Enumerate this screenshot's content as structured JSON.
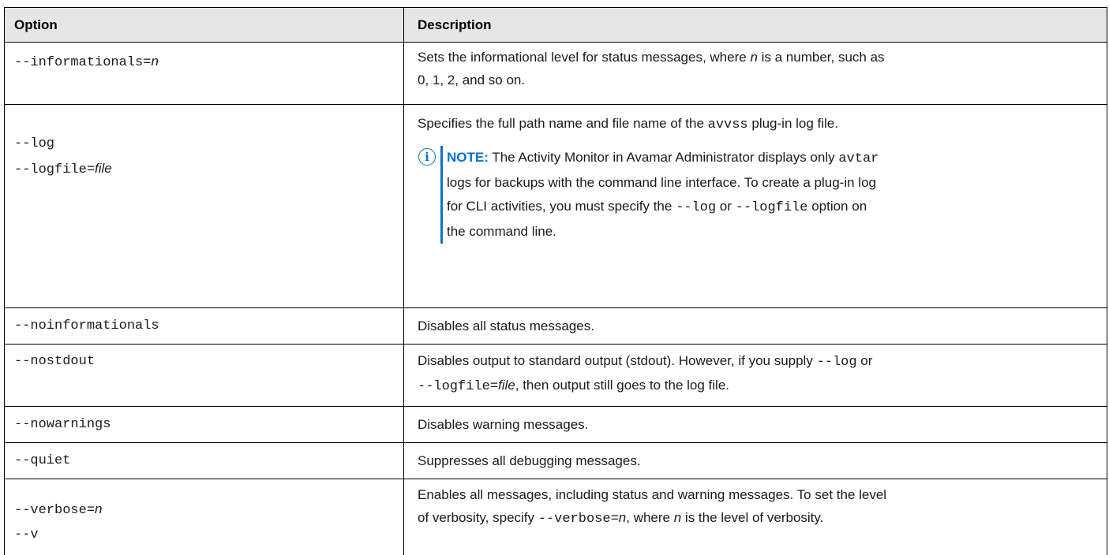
{
  "headers": {
    "option": "Option",
    "description": "Description"
  },
  "rows": {
    "informationals": {
      "opt_prefix": "--informationals=",
      "opt_var": "n",
      "desc_a": "Sets the informational level for status messages, where ",
      "desc_var": "n",
      "desc_b": " is a number, such as",
      "desc_c": "0, 1, 2, and so on."
    },
    "log": {
      "opt1": "--log",
      "opt2_prefix": "--logfile=",
      "opt2_var": "file",
      "desc_a": "Specifies the full path name and file name of the ",
      "desc_code": "avvss",
      "desc_b": " plug-in log file.",
      "note": {
        "label": "NOTE:",
        "icon": "info-icon",
        "l1a": " The Activity Monitor in Avamar Administrator displays only ",
        "l1code": "avtar",
        "l2": "logs for backups with the command line interface. To create a plug-in log",
        "l3a": "for CLI activities, you must specify the ",
        "l3code1": "--log",
        "l3b": " or ",
        "l3code2": "--logfile",
        "l3c": " option on",
        "l4": "the command line."
      }
    },
    "noinformationals": {
      "opt": "--noinformationals",
      "desc": "Disables all status messages."
    },
    "nostdout": {
      "opt": "--nostdout",
      "desc_a": "Disables output to standard output (stdout). However, if you supply ",
      "desc_code1": "--log",
      "desc_b": " or",
      "desc_code2": "--logfile=",
      "desc_var": "file",
      "desc_c": ", then output still goes to the log file."
    },
    "nowarnings": {
      "opt": "--nowarnings",
      "desc": "Disables warning messages."
    },
    "quiet": {
      "opt": "--quiet",
      "desc": "Suppresses all debugging messages."
    },
    "verbose": {
      "opt1_prefix": "--verbose=",
      "opt1_var": "n",
      "opt2": "--v",
      "desc_a": "Enables all messages, including status and warning messages. To set the level",
      "desc_b": "of verbosity, specify ",
      "desc_code": "--verbose=",
      "desc_var1": "n",
      "desc_c": ", where ",
      "desc_var2": "n",
      "desc_d": " is the level of verbosity."
    }
  }
}
